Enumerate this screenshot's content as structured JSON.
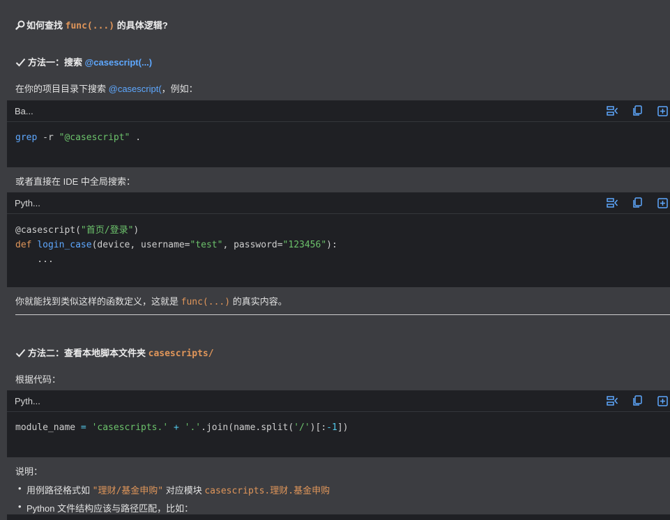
{
  "title": {
    "icon": "magnifier-icon",
    "prefix": "🔎 如何查找 ",
    "code": "func(...)",
    "suffix": " 的具体逻辑?"
  },
  "method1": {
    "check": "✅",
    "label": "方法一：搜索 ",
    "code": "@casescript(...)",
    "desc_prefix": "在你的项目目录下搜索 ",
    "desc_code": "@casescript(",
    "desc_suffix": "，例如："
  },
  "code1": {
    "lang": "Ba...",
    "line": [
      "grep",
      " -r ",
      "\"@casescript\"",
      " ."
    ]
  },
  "or_text": "或者直接在 IDE 中全局搜索：",
  "code2": {
    "lang": "Pyth...",
    "l1_a": "@casescript(",
    "l1_str": "\"首页/登录\"",
    "l1_b": ")",
    "l2_def": "def",
    "l2_fn": "login_case",
    "l2_a": "(device, username=",
    "l2_s1": "\"test\"",
    "l2_b": ", password=",
    "l2_s2": "\"123456\"",
    "l2_c": "):",
    "l3": "    ..."
  },
  "find_text": {
    "prefix": "你就能找到类似这样的函数定义，这就是 ",
    "code": "func(...)",
    "suffix": " 的真实内容。"
  },
  "method2": {
    "check": "✅",
    "label": "方法二：查看本地脚本文件夹 ",
    "code": "casescripts/",
    "desc": "根据代码："
  },
  "code3": {
    "lang": "Pyth...",
    "a": "module_name ",
    "eq": "=",
    "s1": " 'casescripts.' ",
    "plus": "+",
    "s2": " '.'",
    "b": ".join(name.split(",
    "s3": "'/'",
    "c": ")[:",
    "n": "-1",
    "d": "])"
  },
  "explain": {
    "label": "说明：",
    "bullet1_prefix": "用例路径格式如 ",
    "bullet1_code1": "\"理财/基金申购\"",
    "bullet1_mid": " 对应模块 ",
    "bullet1_code2": "casescripts.理财.基金申购",
    "bullet2": "Python 文件结构应该与路径匹配，比如："
  },
  "toolbar_icons": [
    "wrap-lines-icon",
    "copy-icon",
    "insert-icon"
  ]
}
